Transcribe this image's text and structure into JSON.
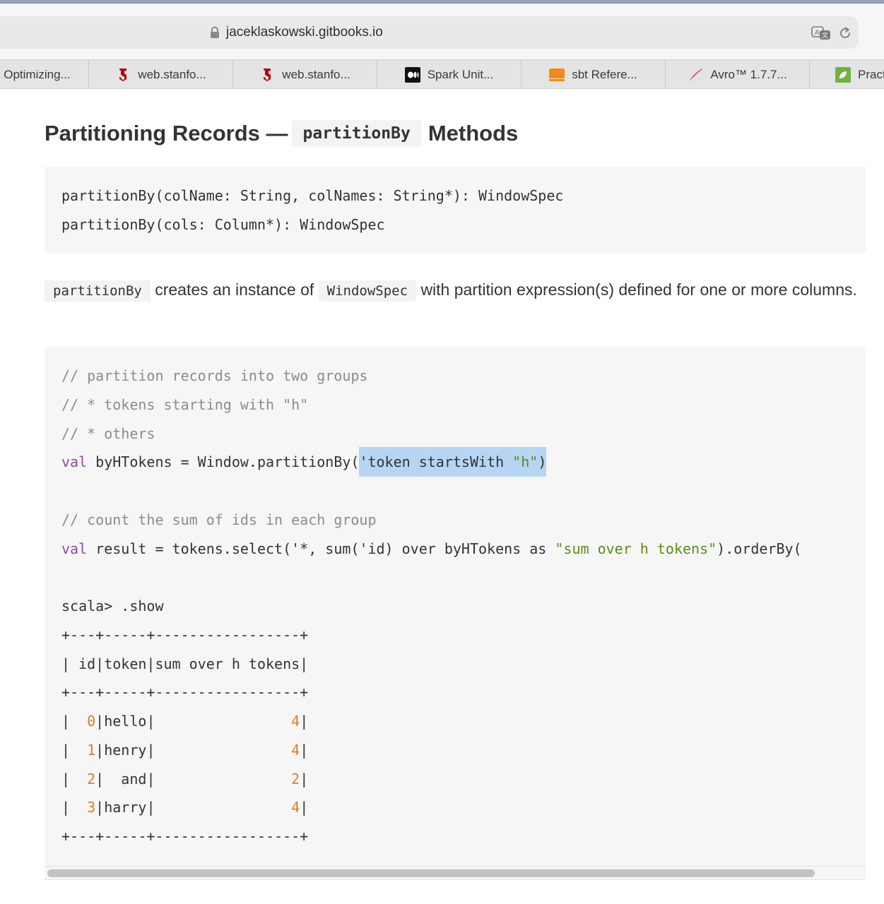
{
  "browser": {
    "url": "jaceklaskowski.gitbooks.io",
    "tabs": [
      {
        "label": "Optimizing...",
        "icon": "none"
      },
      {
        "label": "web.stanfo...",
        "icon": "stanford-logo-icon"
      },
      {
        "label": "web.stanfo...",
        "icon": "stanford-logo-icon"
      },
      {
        "label": "Spark Unit...",
        "icon": "medium-logo-icon"
      },
      {
        "label": "sbt Refere...",
        "icon": "sbt-logo-icon"
      },
      {
        "label": "Avro™ 1.7.7...",
        "icon": "apache-feather-icon"
      },
      {
        "label": "Pract",
        "icon": "leaf-logo-icon"
      }
    ]
  },
  "page": {
    "heading": {
      "prefix": "Partitioning Records — ",
      "code": "partitionBy",
      "suffix": "Methods"
    },
    "signatures": [
      "partitionBy(colName: String, colNames: String*): WindowSpec",
      "partitionBy(cols: Column*): WindowSpec"
    ],
    "paragraph": {
      "code1": "partitionBy",
      "text1": "creates an instance of",
      "code2": "WindowSpec",
      "text2": "with partition expression(s) defined for one or more columns."
    },
    "example": {
      "comment1": "// partition records into two groups",
      "comment2": "// * tokens starting with \"h\"",
      "comment3": "// * others",
      "line4": {
        "kw": "val",
        "pre": " byHTokens = Window.partitionBy(",
        "hl_pre": "'token startsWith ",
        "hl_str": "\"h\"",
        "hl_post": ")"
      },
      "comment5": "// count the sum of ids in each group",
      "line6": {
        "kw": "val",
        "pre": " result = tokens.select('*, sum('id) over byHTokens as ",
        "str": "\"sum over h tokens\"",
        "post": ").orderBy("
      },
      "prompt": "scala> .show",
      "table_border": "+---+-----+-----------------+",
      "table_header": "| id|token|sum over h tokens|",
      "rows": [
        {
          "id": "0",
          "token": "hello",
          "sum": "4"
        },
        {
          "id": "1",
          "token": "henry",
          "sum": "4"
        },
        {
          "id": "2",
          "token": "  and",
          "sum": "2"
        },
        {
          "id": "3",
          "token": "harry",
          "sum": "4"
        }
      ]
    }
  },
  "colors": {
    "keyword": "#8e4aa6",
    "string": "#5c8e14",
    "number": "#e07e20",
    "comment": "#8c8c8c",
    "selection": "#b6d5f3"
  }
}
